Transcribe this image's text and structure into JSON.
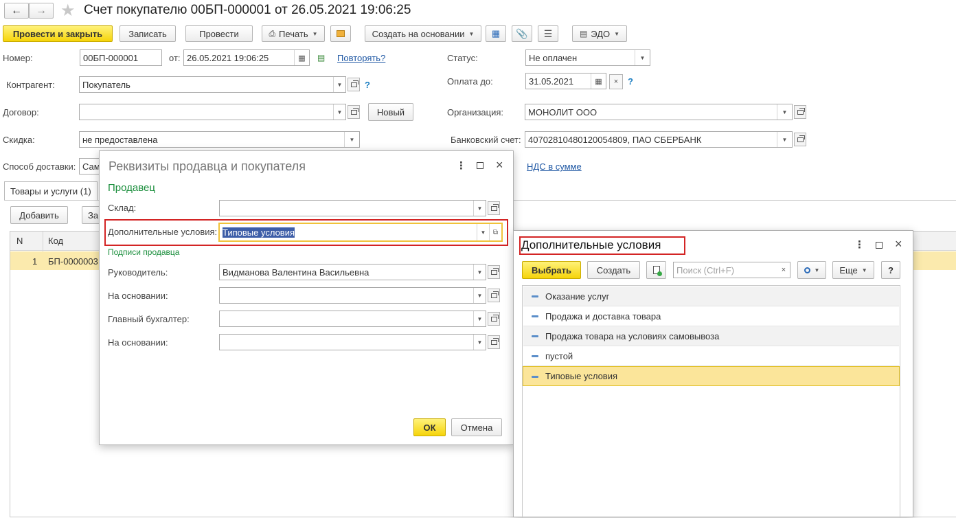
{
  "window": {
    "title": "Счет покупателю 00БП-000001 от 26.05.2021 19:06:25"
  },
  "toolbar": {
    "post_close": "Провести и закрыть",
    "save": "Записать",
    "post": "Провести",
    "print": "Печать",
    "create_based": "Создать на основании",
    "edo": "ЭДО"
  },
  "form": {
    "number_label": "Номер:",
    "number_value": "00БП-000001",
    "from_label": "от:",
    "date_value": "26.05.2021 19:06:25",
    "repeat_link": "Повторять?",
    "status_label": "Статус:",
    "status_value": "Не оплачен",
    "counterparty_label": "Контрагент:",
    "counterparty_value": "Покупатель",
    "pay_until_label": "Оплата до:",
    "pay_until_value": "31.05.2021",
    "contract_label": "Договор:",
    "contract_value": "",
    "new_button": "Новый",
    "org_label": "Организация:",
    "org_value": "МОНОЛИТ ООО",
    "discount_label": "Скидка:",
    "discount_value": "не предоставлена",
    "bank_label": "Банковский счет:",
    "bank_value": "40702810480120054809, ПАО СБЕРБАНК",
    "delivery_label": "Способ доставки:",
    "delivery_value": "Сам",
    "vat_link": "НДС в сумме",
    "question": "?"
  },
  "tabs": [
    {
      "label": "Товары и услуги (1)"
    }
  ],
  "table": {
    "add_button": "Добавить",
    "fill_button": "За",
    "columns": [
      "N",
      "Код"
    ],
    "rows": [
      {
        "n": "1",
        "code": "БП-0000003"
      }
    ]
  },
  "seller_dialog": {
    "title": "Реквизиты продавца и покупателя",
    "section": "Продавец",
    "warehouse_label": "Склад:",
    "warehouse_value": "",
    "terms_label": "Дополнительные условия:",
    "terms_value": "Типовые условия",
    "signatures_title": "Подписи продавца",
    "head_label": "Руководитель:",
    "head_value": "Видманова Валентина Васильевна",
    "basis_label": "На основании:",
    "chief_accountant_label": "Главный бухгалтер:",
    "basis2_label": "На основании:",
    "ok": "ОК",
    "cancel": "Отмена"
  },
  "terms_dialog": {
    "title": "Дополнительные условия",
    "select": "Выбрать",
    "create": "Создать",
    "search_placeholder": "Поиск (Ctrl+F)",
    "more": "Еще",
    "help": "?",
    "items": [
      {
        "label": "Оказание услуг"
      },
      {
        "label": "Продажа и доставка товара"
      },
      {
        "label": "Продажа товара на условиях самовывоза"
      },
      {
        "label": "пустой"
      },
      {
        "label": "Типовые условия"
      }
    ]
  }
}
